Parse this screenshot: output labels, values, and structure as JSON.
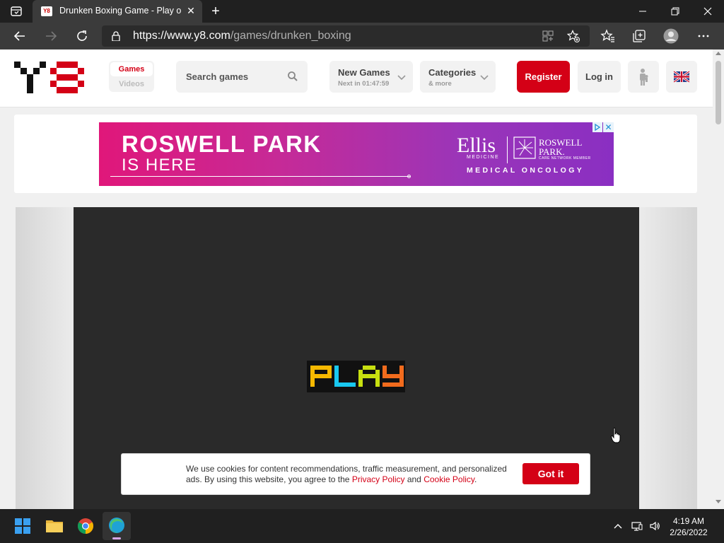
{
  "browser": {
    "tab_title": "Drunken Boxing Game - Play onl",
    "favicon_text": "Y8",
    "url_host": "https://www.y8.com",
    "url_path": "/games/drunken_boxing"
  },
  "site": {
    "brand_color": "#d40016",
    "segment": {
      "active": "Games",
      "inactive": "Videos"
    },
    "search": {
      "placeholder": "Search games"
    },
    "new_games": {
      "title": "New Games",
      "subtitle": "Next in 01:47:59"
    },
    "categories": {
      "title": "Categories",
      "subtitle": "& more"
    },
    "register_label": "Register",
    "login_label": "Log in"
  },
  "ad": {
    "headline": "ROSWELL PARK",
    "subhead": "IS HERE",
    "ellis": "Ellis",
    "medicine": "MEDICINE",
    "roswell_line1": "ROSWELL",
    "roswell_line2": "PARK.",
    "member": "CARE NETWORK MEMBER",
    "oncology": "MEDICAL ONCOLOGY"
  },
  "game": {
    "play_letters": [
      "P",
      "L",
      "A",
      "Y"
    ],
    "play_colors": [
      "#f5b800",
      "#19c8f0",
      "#c8e010",
      "#f26b1d"
    ]
  },
  "cookie": {
    "text_before": "We use cookies for content recommendations, traffic measurement, and personalized ads. By using this website, you agree to the ",
    "privacy_link": "Privacy Policy",
    "and": " and ",
    "cookie_link": "Cookie Policy",
    "end": ".",
    "button": "Got it"
  },
  "taskbar": {
    "time": "4:19 AM",
    "date": "2/26/2022"
  }
}
